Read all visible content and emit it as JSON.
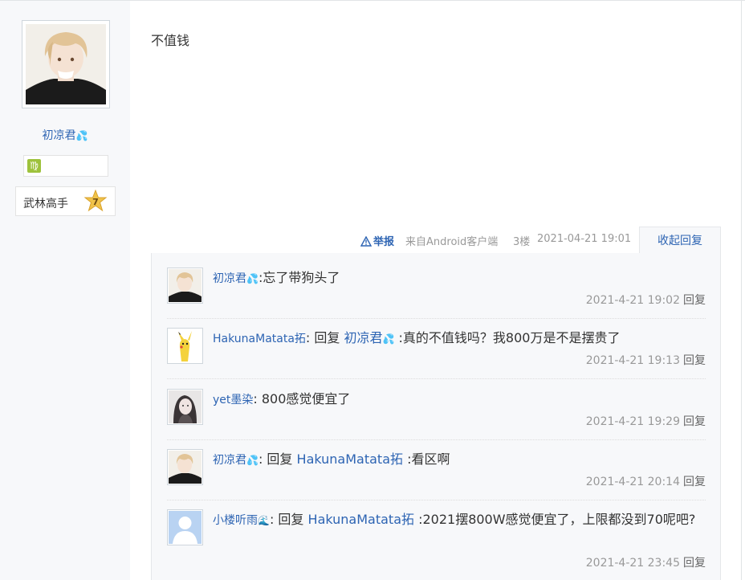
{
  "author": {
    "username": "初凉君",
    "username_emoji": "💦",
    "zodiac_icon": "♍",
    "level_title": "武林高手",
    "level_number": "7"
  },
  "post": {
    "content": "不值钱",
    "report_label": "举报",
    "source": "来自Android客户端",
    "floor": "3楼",
    "time": "2021-04-21 19:01",
    "collapse_label": "收起回复"
  },
  "replies": [
    {
      "user": "初凉君",
      "user_emoji": "💦",
      "prefix": "",
      "target": "",
      "target_emoji": "",
      "text": ":忘了带狗头了",
      "time": "2021-4-21 19:02",
      "reply_label": "回复"
    },
    {
      "user": "HakunaMatata拓",
      "user_emoji": "",
      "prefix": ": 回复 ",
      "target": "初凉君",
      "target_emoji": "💦",
      "text": " :真的不值钱吗？我800万是不是摆贵了",
      "time": "2021-4-21 19:13",
      "reply_label": "回复"
    },
    {
      "user": "yet墨染",
      "user_emoji": "",
      "prefix": "",
      "target": "",
      "target_emoji": "",
      "text": ": 800感觉便宜了",
      "time": "2021-4-21 19:29",
      "reply_label": "回复"
    },
    {
      "user": "初凉君",
      "user_emoji": "💦",
      "prefix": ": 回复 ",
      "target": "HakunaMatata拓",
      "target_emoji": "",
      "text": " :看区啊",
      "time": "2021-4-21 20:14",
      "reply_label": "回复"
    },
    {
      "user": "小楼听雨",
      "user_emoji": "🌊",
      "prefix": ": 回复 ",
      "target": "HakunaMatata拓",
      "target_emoji": "",
      "text": " :2021摆800W感觉便宜了，上限都没到70呢吧?",
      "time": "2021-4-21 23:45",
      "reply_label": "回复"
    }
  ],
  "colors": {
    "link": "#2d64b3",
    "sidebar_bg": "#f7f8fa",
    "meta_text": "#999999"
  }
}
